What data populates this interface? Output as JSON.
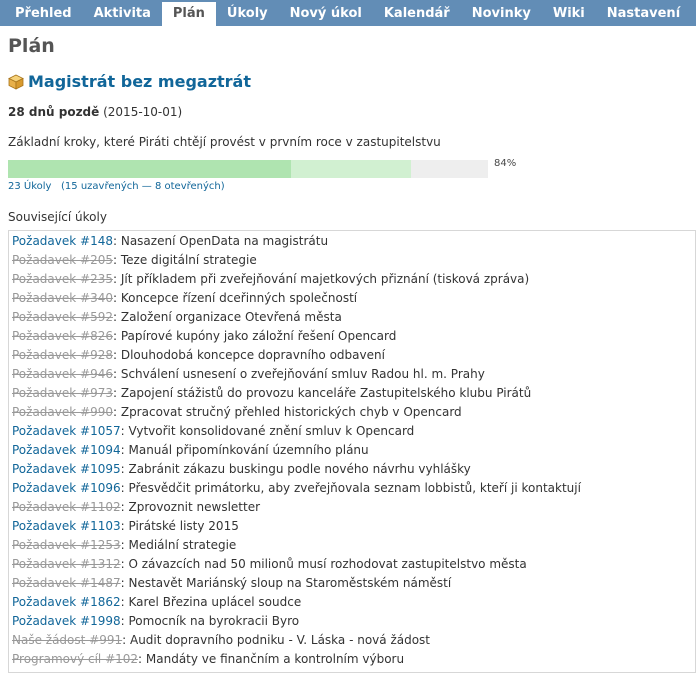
{
  "nav": {
    "tabs": [
      {
        "label": "Přehled"
      },
      {
        "label": "Aktivita"
      },
      {
        "label": "Plán"
      },
      {
        "label": "Úkoly"
      },
      {
        "label": "Nový úkol"
      },
      {
        "label": "Kalendář"
      },
      {
        "label": "Novinky"
      },
      {
        "label": "Wiki"
      },
      {
        "label": "Nastavení"
      }
    ],
    "selected": "Plán"
  },
  "page_title": "Plán",
  "version": {
    "icon": "package-icon",
    "name": "Magistrát bez megaztrát",
    "due_late": "28 dnů pozdě",
    "due_date": "(2015-10-01)",
    "description": "Základní kroky, které Piráti chtějí provést v prvním roce v zastupitelstvu",
    "closed_fraction": 0.59,
    "done_fraction": 0.25,
    "percent_label": "84%",
    "issue_count_label": "23 Úkoly",
    "closed_label": "15 uzavřených",
    "separator": "—",
    "open_label": "8 otevřených"
  },
  "related": {
    "title": "Související úkoly",
    "issues": [
      {
        "id": "Požadavek #148",
        "subject": "Nasazení OpenData na magistrátu",
        "closed": false
      },
      {
        "id": "Požadavek #205",
        "subject": "Teze digitální strategie",
        "closed": true
      },
      {
        "id": "Požadavek #235",
        "subject": "Jít příkladem při zveřejňování majetkových přiznání (tisková zpráva)",
        "closed": true
      },
      {
        "id": "Požadavek #340",
        "subject": "Koncepce řízení dceřinných společností",
        "closed": true
      },
      {
        "id": "Požadavek #592",
        "subject": "Založení organizace Otevřená města",
        "closed": true
      },
      {
        "id": "Požadavek #826",
        "subject": "Papírové kupóny jako záložní řešení Opencard",
        "closed": true
      },
      {
        "id": "Požadavek #928",
        "subject": "Dlouhodobá koncepce dopravního odbavení",
        "closed": true
      },
      {
        "id": "Požadavek #946",
        "subject": "Schválení usnesení o zveřejňování smluv Radou hl. m. Prahy",
        "closed": true
      },
      {
        "id": "Požadavek #973",
        "subject": "Zapojení stážistů do provozu kanceláře Zastupitelského klubu Pirátů",
        "closed": true
      },
      {
        "id": "Požadavek #990",
        "subject": "Zpracovat stručný přehled historických chyb v Opencard",
        "closed": true
      },
      {
        "id": "Požadavek #1057",
        "subject": "Vytvořit konsolidované znění smluv k Opencard",
        "closed": false
      },
      {
        "id": "Požadavek #1094",
        "subject": "Manuál připomínkování územního plánu",
        "closed": false
      },
      {
        "id": "Požadavek #1095",
        "subject": "Zabránit zákazu buskingu podle nového návrhu vyhlášky",
        "closed": false
      },
      {
        "id": "Požadavek #1096",
        "subject": "Přesvědčit primátorku, aby zveřejňovala seznam lobbistů, kteří ji kontaktují",
        "closed": false
      },
      {
        "id": "Požadavek #1102",
        "subject": "Zprovoznit newsletter",
        "closed": true
      },
      {
        "id": "Požadavek #1103",
        "subject": "Pirátské listy 2015",
        "closed": false
      },
      {
        "id": "Požadavek #1253",
        "subject": "Mediální strategie",
        "closed": true
      },
      {
        "id": "Požadavek #1312",
        "subject": "O závazcích nad 50 milionů musí rozhodovat zastupitelstvo města",
        "closed": true
      },
      {
        "id": "Požadavek #1487",
        "subject": "Nestavět Mariánský sloup na Staroměstském náměstí",
        "closed": true
      },
      {
        "id": "Požadavek #1862",
        "subject": "Karel Březina uplácel soudce",
        "closed": false
      },
      {
        "id": "Požadavek #1998",
        "subject": "Pomocník na byrokracii Byro",
        "closed": false
      },
      {
        "id": "Naše žádost #991",
        "subject": "Audit dopravního podniku - V. Láska - nová žádost",
        "closed": true
      },
      {
        "id": "Programový cíl #102",
        "subject": "Mandáty ve finančním a kontrolním výboru",
        "closed": true
      }
    ]
  },
  "colors": {
    "nav_bg": "#628db6",
    "link": "#116699",
    "progress_closed": "#afe4b0",
    "progress_done": "#d1f0d1",
    "progress_todo": "#eeeeee"
  }
}
